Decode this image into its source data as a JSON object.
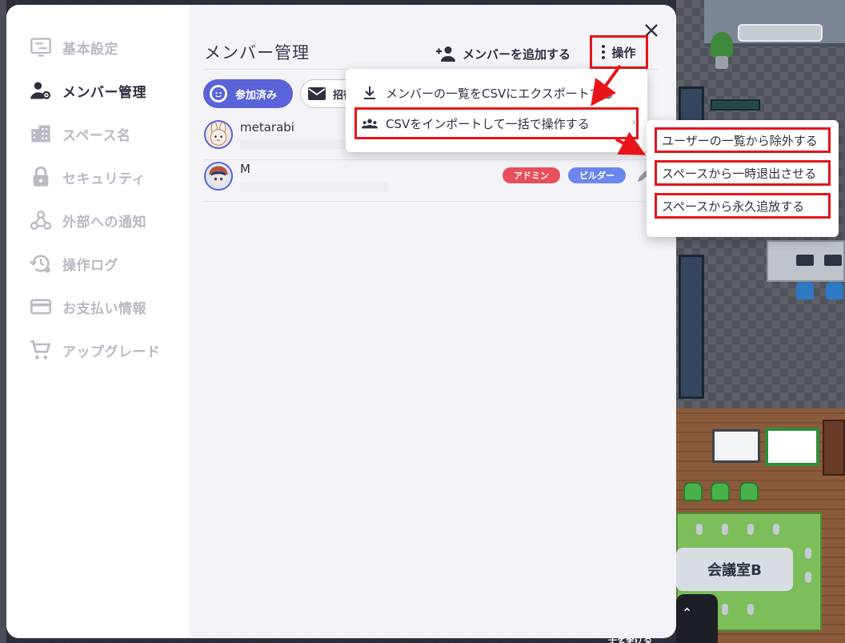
{
  "sidebar": {
    "items": [
      {
        "label": "基本設定",
        "icon": "settings-panel-icon",
        "active": false
      },
      {
        "label": "メンバー管理",
        "icon": "member-settings-icon",
        "active": true
      },
      {
        "label": "スペース名",
        "icon": "building-icon",
        "active": false
      },
      {
        "label": "セキュリティ",
        "icon": "lock-icon",
        "active": false
      },
      {
        "label": "外部への通知",
        "icon": "webhook-icon",
        "active": false
      },
      {
        "label": "操作ログ",
        "icon": "history-icon",
        "active": false
      },
      {
        "label": "お支払い情報",
        "icon": "credit-card-icon",
        "active": false
      },
      {
        "label": "アップグレード",
        "icon": "cart-icon",
        "active": false
      }
    ]
  },
  "header": {
    "title": "メンバー管理",
    "add_member_label": "メンバーを追加する",
    "operations_label": "操作"
  },
  "filters": {
    "joined_label": "参加済み",
    "invite_label": "招待"
  },
  "members": [
    {
      "name": "metarabi",
      "badges": []
    },
    {
      "name": "M",
      "badges": [
        {
          "label": "アドミン",
          "color": "#e8505b"
        },
        {
          "label": "ビルダー",
          "color": "#6b86ec"
        }
      ]
    }
  ],
  "dropdown": {
    "items": [
      {
        "label": "メンバーの一覧をCSVにエクスポートする",
        "icon": "download-icon"
      },
      {
        "label": "CSVをインポートして一括で操作する",
        "icon": "group-icon",
        "has_submenu": true
      }
    ]
  },
  "submenu": {
    "items": [
      {
        "label": "ユーザーの一覧から除外する"
      },
      {
        "label": "スペースから一時退出させる"
      },
      {
        "label": "スペースから永久追放する"
      }
    ]
  },
  "world": {
    "meeting_room_label": "会議室B",
    "dock_text": "手を挙げる"
  },
  "colors": {
    "accent": "#5a63d8",
    "highlight": "#e8141a",
    "admin_badge": "#e8505b",
    "builder_badge": "#6b86ec"
  }
}
